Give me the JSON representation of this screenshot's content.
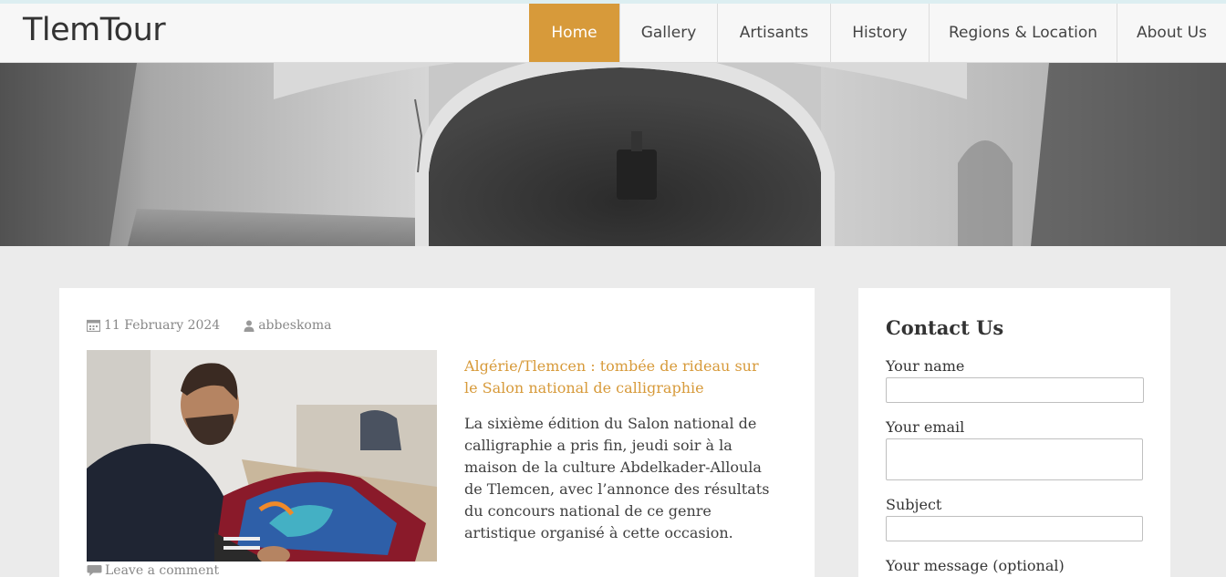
{
  "site": {
    "logo": "TlemTour"
  },
  "nav": {
    "items": [
      {
        "label": "Home",
        "active": true
      },
      {
        "label": "Gallery"
      },
      {
        "label": "Artisants"
      },
      {
        "label": "History"
      },
      {
        "label": "Regions & Location"
      },
      {
        "label": "About Us"
      }
    ]
  },
  "post": {
    "date": "11 February 2024",
    "author": "abbeskoma",
    "title": "Algérie/Tlemcen : tombée de rideau sur le Salon national de calligraphie",
    "excerpt": "La sixième édition du Salon national de calligraphie a pris fin, jeudi soir à la maison de la culture Abdelkader-Alloula de Tlemcen, avec l’annonce des résultats du concours national de ce genre artistique organisé à cette occasion.",
    "comment_link": "Leave a comment"
  },
  "contact": {
    "title": "Contact Us",
    "name_label": "Your name",
    "name_value": "",
    "email_label": "Your email",
    "email_value": "",
    "subject_label": "Subject",
    "subject_value": "",
    "message_label": "Your message (optional)"
  },
  "colors": {
    "accent": "#d79a3a",
    "background": "#ebebeb",
    "header": "#f7f7f7"
  },
  "icons": {
    "date": "calendar-icon",
    "author": "user-icon",
    "comment": "comment-icon"
  }
}
